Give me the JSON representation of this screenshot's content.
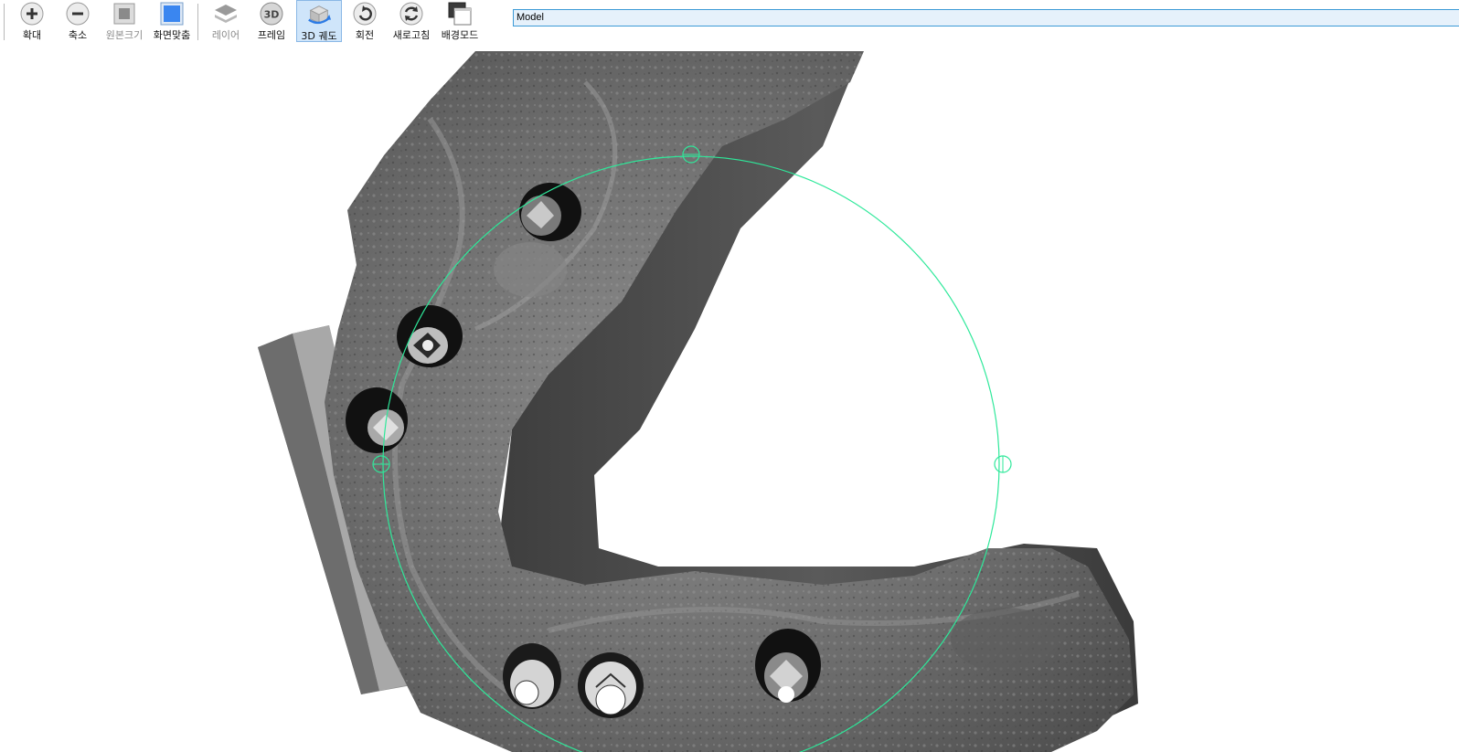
{
  "toolbar": {
    "zoom_in": {
      "label": "확대",
      "icon": "plus-circle-icon",
      "enabled": true
    },
    "zoom_out": {
      "label": "축소",
      "icon": "minus-circle-icon",
      "enabled": true
    },
    "original_size": {
      "label": "원본크기",
      "icon": "original-size-icon",
      "enabled": false
    },
    "fit_screen": {
      "label": "화면맞춤",
      "icon": "fit-screen-icon",
      "enabled": true
    },
    "layer": {
      "label": "레이어",
      "icon": "layers-icon",
      "enabled": false
    },
    "frame": {
      "label": "프레임",
      "icon": "3d-frame-icon",
      "enabled": true
    },
    "orbit_3d": {
      "label": "3D 궤도",
      "icon": "3d-orbit-icon",
      "enabled": true,
      "active": true
    },
    "rotate": {
      "label": "회전",
      "icon": "rotate-icon",
      "enabled": true
    },
    "refresh": {
      "label": "새로고침",
      "icon": "refresh-icon",
      "enabled": true
    },
    "background_mode": {
      "label": "배경모드",
      "icon": "background-mode-icon",
      "enabled": true
    }
  },
  "model_field": {
    "value": "Model"
  },
  "viewport": {
    "object": "dental-arch-scan-model",
    "orbit_circle_color": "#2ee89a",
    "model_color": "#6e6e6e"
  }
}
